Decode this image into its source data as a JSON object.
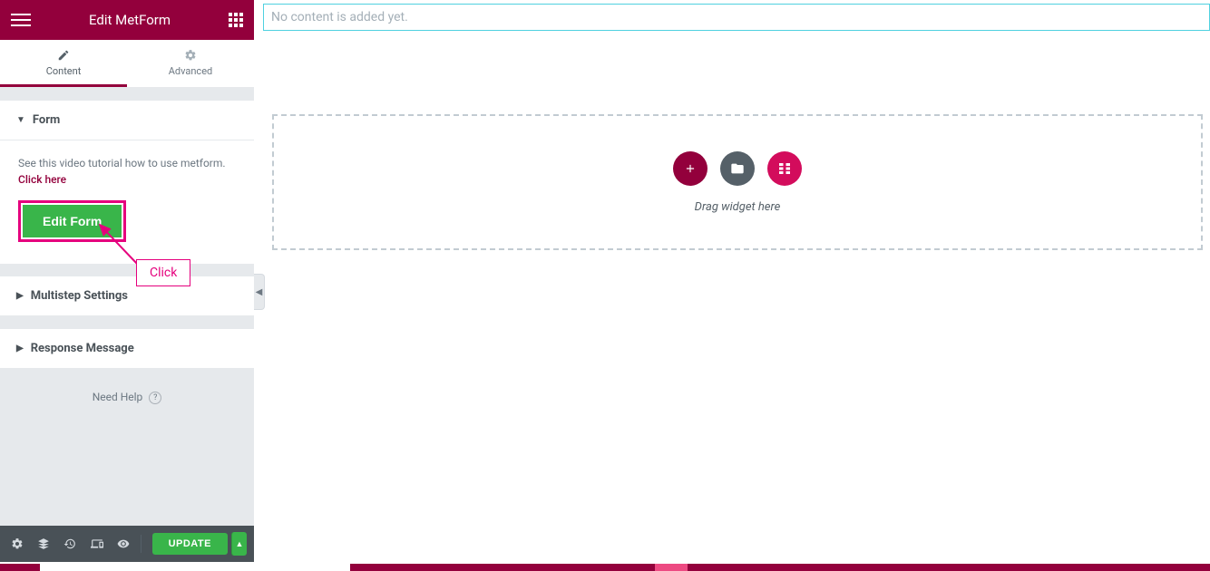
{
  "header": {
    "title": "Edit MetForm"
  },
  "tabs": {
    "content": "Content",
    "advanced": "Advanced"
  },
  "sections": {
    "form": {
      "title": "Form",
      "tutorial_prefix": "See this video tutorial how to use metform. ",
      "tutorial_link": "Click here",
      "edit_button": "Edit Form"
    },
    "multistep": {
      "title": "Multistep Settings"
    },
    "response": {
      "title": "Response Message"
    }
  },
  "help": {
    "label": "Need Help"
  },
  "bottom_bar": {
    "update": "UPDATE"
  },
  "canvas": {
    "no_content": "No content is added yet.",
    "drag_text": "Drag widget here"
  },
  "annotation": {
    "click": "Click"
  }
}
